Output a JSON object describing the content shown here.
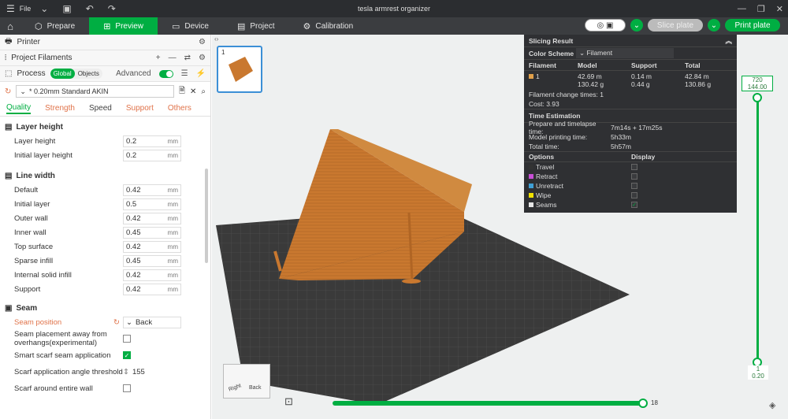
{
  "window": {
    "title": "tesla armrest organizer",
    "file_menu": "File"
  },
  "tabs": [
    {
      "label": "Prepare"
    },
    {
      "label": "Preview"
    },
    {
      "label": "Device"
    },
    {
      "label": "Project"
    },
    {
      "label": "Calibration"
    }
  ],
  "toolbar": {
    "slice_label": "Slice plate",
    "print_label": "Print plate"
  },
  "left": {
    "printer": "Printer",
    "filaments": "Project Filaments",
    "process": "Process",
    "seg_global": "Global",
    "seg_objects": "Objects",
    "advanced": "Advanced",
    "preset": "* 0.20mm Standard AKIN",
    "subtabs": [
      "Quality",
      "Strength",
      "Speed",
      "Support",
      "Others"
    ],
    "layer_height": {
      "title": "Layer height",
      "rows": [
        {
          "label": "Layer height",
          "value": "0.2",
          "unit": "mm"
        },
        {
          "label": "Initial layer height",
          "value": "0.2",
          "unit": "mm"
        }
      ]
    },
    "line_width": {
      "title": "Line width",
      "rows": [
        {
          "label": "Default",
          "value": "0.42",
          "unit": "mm"
        },
        {
          "label": "Initial layer",
          "value": "0.5",
          "unit": "mm"
        },
        {
          "label": "Outer wall",
          "value": "0.42",
          "unit": "mm"
        },
        {
          "label": "Inner wall",
          "value": "0.45",
          "unit": "mm"
        },
        {
          "label": "Top surface",
          "value": "0.42",
          "unit": "mm"
        },
        {
          "label": "Sparse infill",
          "value": "0.45",
          "unit": "mm"
        },
        {
          "label": "Internal solid infill",
          "value": "0.42",
          "unit": "mm"
        },
        {
          "label": "Support",
          "value": "0.42",
          "unit": "mm"
        }
      ]
    },
    "seam": {
      "title": "Seam",
      "position_label": "Seam position",
      "position_value": "Back",
      "away_label": "Seam placement away from overhangs(experimental)",
      "scarf_label": "Smart scarf seam application",
      "angle_label": "Scarf application angle threshold",
      "angle_value": "155",
      "around_label": "Scarf around entire wall"
    }
  },
  "thumb": {
    "index": "1"
  },
  "slicing": {
    "title": "Slicing Result",
    "color_scheme_label": "Color Scheme",
    "color_scheme_value": "Filament",
    "cols": [
      "Filament",
      "Model",
      "Support",
      "Total"
    ],
    "filament_row": {
      "id": "1",
      "model_m": "42.69 m",
      "model_g": "130.42 g",
      "support_m": "0.14 m",
      "support_g": "0.44 g",
      "total_m": "42.84 m",
      "total_g": "130.86 g"
    },
    "change_times": "Filament change times:  1",
    "cost": "Cost:  3.93",
    "time_title": "Time Estimation",
    "prep_label": "Prepare and timelapse time:",
    "prep_value": "7m14s + 17m25s",
    "model_label": "Model printing time:",
    "model_value": "5h33m",
    "total_label": "Total time:",
    "total_value": "5h57m",
    "options_label": "Options",
    "display_label": "Display",
    "options": [
      {
        "label": "Travel",
        "color": "#333333"
      },
      {
        "label": "Retract",
        "color": "#c84fd6"
      },
      {
        "label": "Unretract",
        "color": "#3fa0d6"
      },
      {
        "label": "Wipe",
        "color": "#f0e000"
      },
      {
        "label": "Seams",
        "color": "#e6e6e6"
      }
    ]
  },
  "vslider": {
    "top_layer": "720",
    "top_height": "144.00",
    "bottom_layer": "1",
    "bottom_height": "0.20"
  },
  "hslider": {
    "value": "18"
  },
  "cube": {
    "right": "Right",
    "back": "Back"
  },
  "colors": {
    "accent": "#00ae42",
    "filament": "#c9782f",
    "orange_label": "#e0734a"
  }
}
